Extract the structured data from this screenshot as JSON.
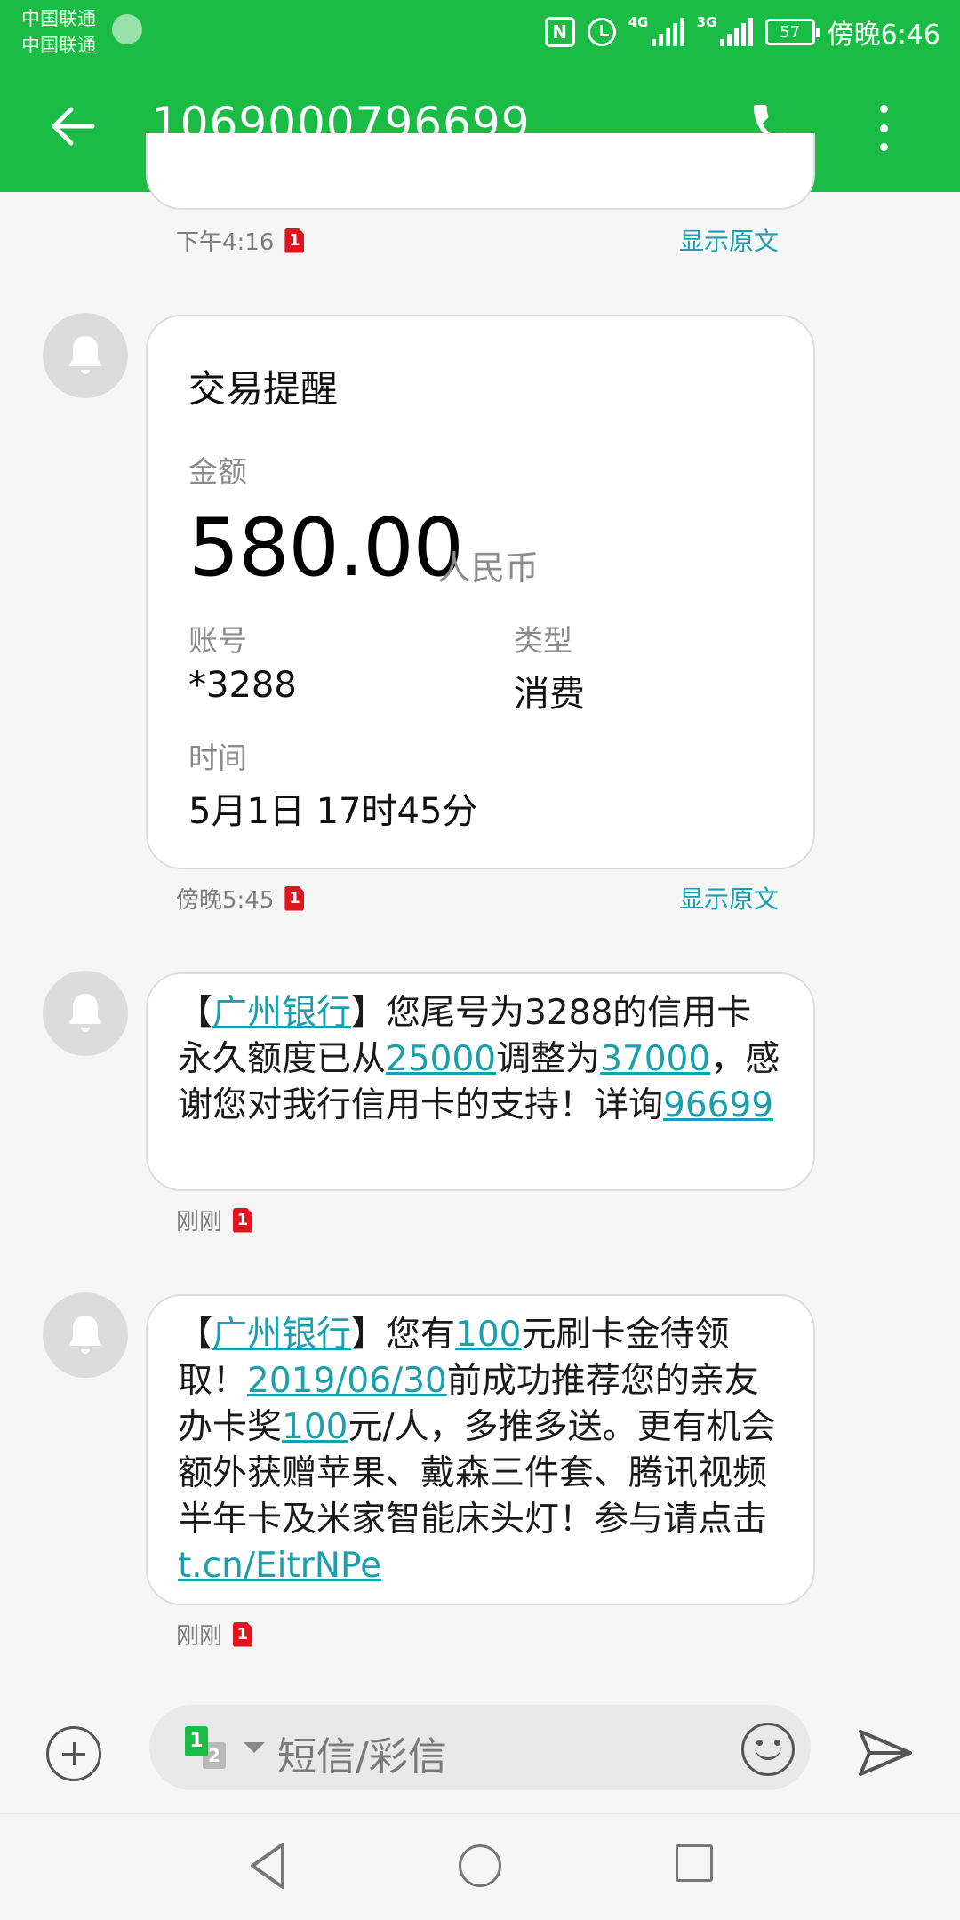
{
  "status_bar": {
    "carrier1": "中国联通",
    "carrier2": "中国联通",
    "nfc": "N",
    "network1": "4G",
    "network2": "3G",
    "battery": "57",
    "time": "傍晚6:46"
  },
  "header": {
    "title": "1069000796699"
  },
  "colors": {
    "brand": "#1bbc45",
    "link": "#1aa0ad",
    "sim_badge": "#e0161f"
  },
  "messages": {
    "m0": {
      "time": "下午4:16",
      "sim": "1",
      "show_original": "显示原文"
    },
    "m1": {
      "card_title": "交易提醒",
      "amount_label": "金额",
      "amount": "580.00",
      "currency": "人民币",
      "account_label": "账号",
      "account": "*3288",
      "type_label": "类型",
      "type": "消费",
      "time_label": "时间",
      "time_value": "5月1日 17时45分",
      "time": "傍晚5:45",
      "sim": "1",
      "show_original": "显示原文"
    },
    "m2": {
      "p1": "【",
      "bank": "广州银行",
      "p2": "】您尾号为3288的信用卡永久额度已从",
      "old_limit": "25000",
      "p3": "调整为",
      "new_limit": "37000",
      "p4": "，感谢您对我行信用卡的支持！详询",
      "hotline": "96699",
      "time": "刚刚",
      "sim": "1"
    },
    "m3": {
      "p1": "【",
      "bank": "广州银行",
      "p2": "】您有",
      "amount1": "100",
      "p3": "元刷卡金待领取！",
      "date": "2019/06/30",
      "p4": "前成功推荐您的亲友办卡奖",
      "amount2": "100",
      "p5": "元/人，多推多送。更有机会额外获赠苹果、戴森三件套、腾讯视频半年卡及米家智能床头灯！参与请点击 ",
      "link": "t.cn/EitrNPe",
      "time": "刚刚",
      "sim": "1"
    }
  },
  "input": {
    "sim1": "1",
    "sim2": "2",
    "placeholder": "短信/彩信"
  },
  "icons": {
    "back": "arrow-left-icon",
    "call": "phone-icon",
    "more": "more-vertical-icon",
    "avatar": "bell-icon",
    "add": "plus-circle-icon",
    "emoji": "smiley-icon",
    "send": "send-icon"
  }
}
